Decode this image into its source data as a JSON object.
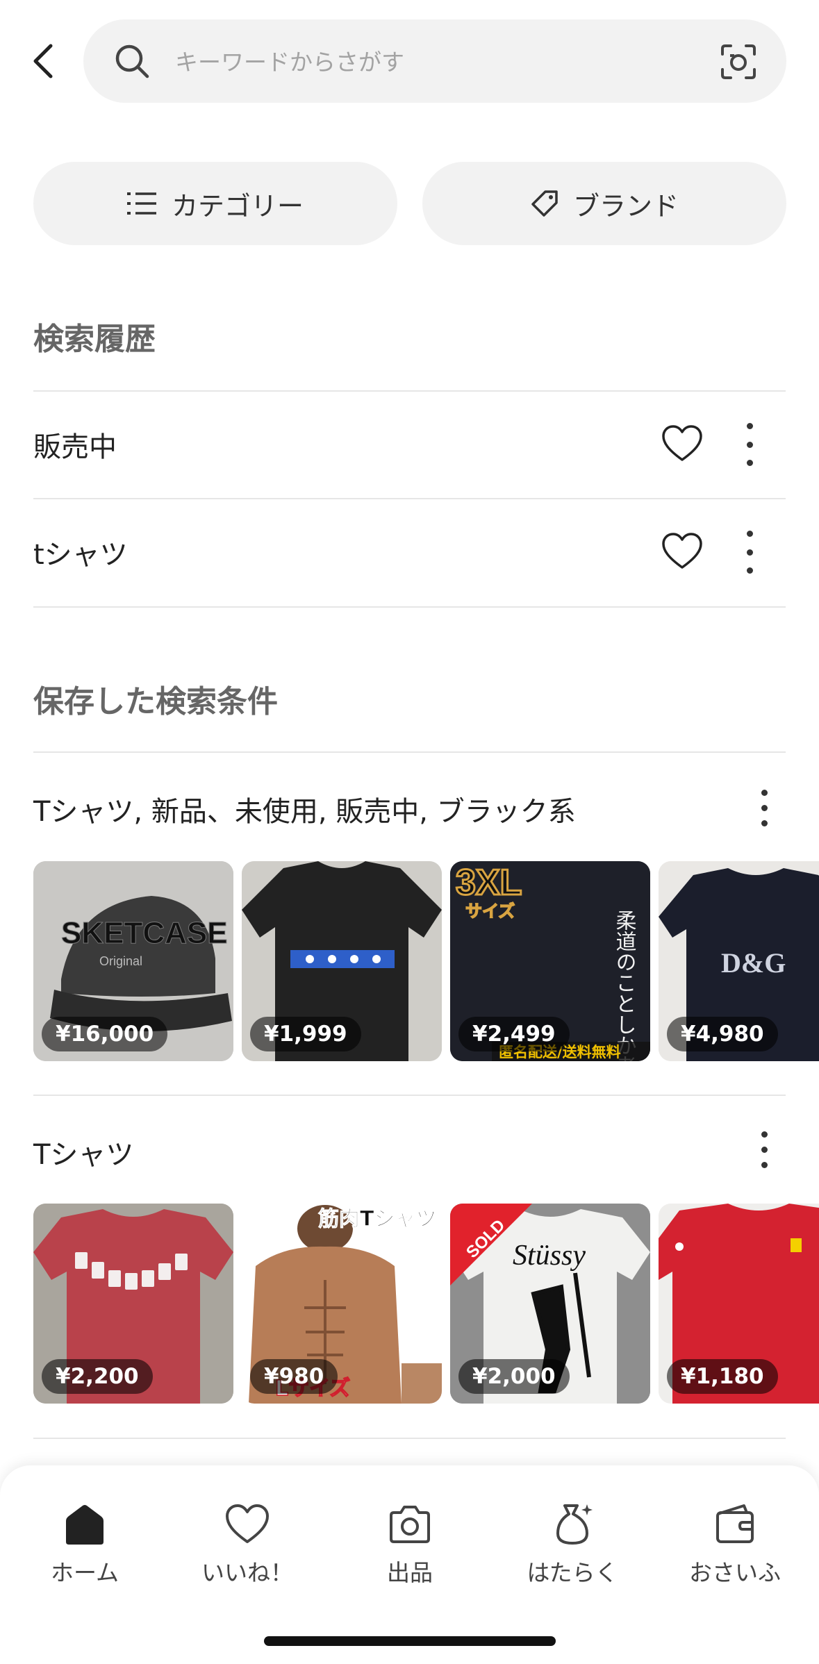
{
  "search": {
    "placeholder": "キーワードからさがす"
  },
  "filters": {
    "category_label": "カテゴリー",
    "brand_label": "ブランド"
  },
  "history": {
    "title": "検索履歴",
    "items": [
      {
        "label": "販売中"
      },
      {
        "label": "tシャツ"
      }
    ]
  },
  "saved": {
    "title": "保存した検索条件",
    "searches": [
      {
        "label": "Tシャツ, 新品、未使用, 販売中, ブラック系",
        "items": [
          {
            "price": "¥16,000",
            "overlay": "SKETCASE",
            "sub": "Original"
          },
          {
            "price": "¥1,999"
          },
          {
            "price": "¥2,499",
            "overlay": "3XL",
            "sub": "サイズ",
            "text": "柔道のことしか考えてません。",
            "banner": "匿名配送/送料無料"
          },
          {
            "price": "¥4,980",
            "overlay": "D&G"
          }
        ]
      },
      {
        "label": "Tシャツ",
        "items": [
          {
            "price": "¥2,200"
          },
          {
            "price": "¥980",
            "overlay": "筋肉Tシャツ",
            "sub": "Lサイズ"
          },
          {
            "price": "¥2,000",
            "badge": "SOLD",
            "overlay": "Stüssy"
          },
          {
            "price": "¥1,180"
          }
        ]
      }
    ]
  },
  "nav": {
    "items": [
      {
        "label": "ホーム",
        "icon": "home-icon"
      },
      {
        "label": "いいね！",
        "icon": "heart-icon"
      },
      {
        "label": "出品",
        "icon": "camera-icon"
      },
      {
        "label": "はたらく",
        "icon": "money-bag-icon"
      },
      {
        "label": "おさいふ",
        "icon": "wallet-icon"
      }
    ]
  }
}
